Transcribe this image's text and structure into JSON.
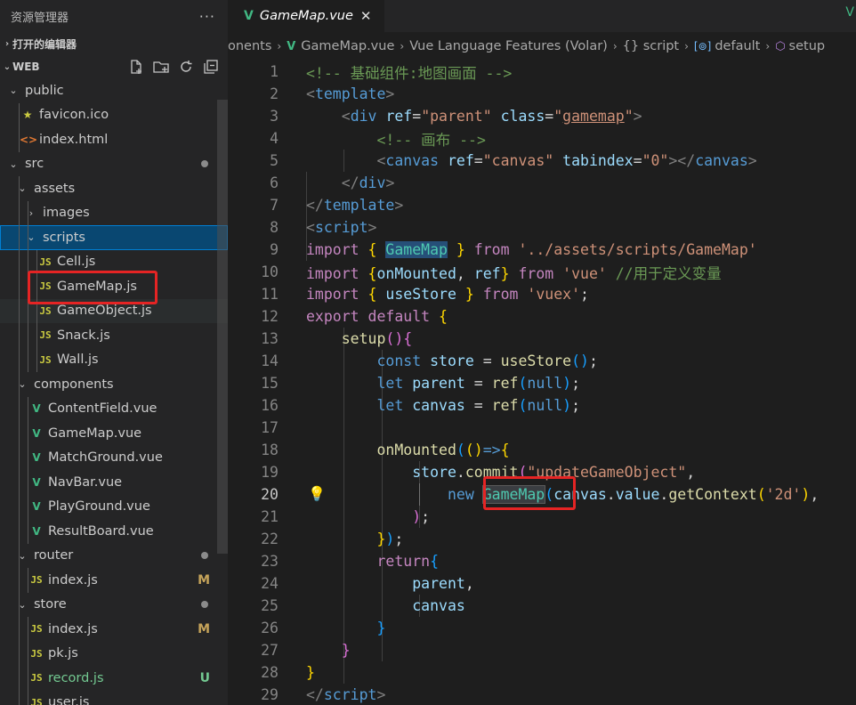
{
  "sidebar": {
    "title": "资源管理器",
    "more": "···",
    "open_editors": "打开的编辑器",
    "workspace": "WEB",
    "tree": [
      {
        "label": "public",
        "type": "folder",
        "depth": 0,
        "open": true
      },
      {
        "label": "favicon.ico",
        "type": "star",
        "depth": 1
      },
      {
        "label": "index.html",
        "type": "html",
        "depth": 1
      },
      {
        "label": "src",
        "type": "folder",
        "depth": 0,
        "open": true,
        "dot": true
      },
      {
        "label": "assets",
        "type": "folder",
        "depth": 1,
        "open": true
      },
      {
        "label": "images",
        "type": "folder",
        "depth": 2,
        "open": false
      },
      {
        "label": "scripts",
        "type": "folder",
        "depth": 2,
        "open": true,
        "selected": true
      },
      {
        "label": "Cell.js",
        "type": "js",
        "depth": 3
      },
      {
        "label": "GameMap.js",
        "type": "js",
        "depth": 3
      },
      {
        "label": "GameObject.js",
        "type": "js",
        "depth": 3,
        "hover": true
      },
      {
        "label": "Snack.js",
        "type": "js",
        "depth": 3
      },
      {
        "label": "Wall.js",
        "type": "js",
        "depth": 3
      },
      {
        "label": "components",
        "type": "folder",
        "depth": 1,
        "open": true
      },
      {
        "label": "ContentField.vue",
        "type": "vue",
        "depth": 2
      },
      {
        "label": "GameMap.vue",
        "type": "vue",
        "depth": 2
      },
      {
        "label": "MatchGround.vue",
        "type": "vue",
        "depth": 2
      },
      {
        "label": "NavBar.vue",
        "type": "vue",
        "depth": 2
      },
      {
        "label": "PlayGround.vue",
        "type": "vue",
        "depth": 2
      },
      {
        "label": "ResultBoard.vue",
        "type": "vue",
        "depth": 2
      },
      {
        "label": "router",
        "type": "folder",
        "depth": 1,
        "open": true,
        "dot": true
      },
      {
        "label": "index.js",
        "type": "js",
        "depth": 2,
        "badge": "M"
      },
      {
        "label": "store",
        "type": "folder",
        "depth": 1,
        "open": true,
        "dot": true
      },
      {
        "label": "index.js",
        "type": "js",
        "depth": 2,
        "badge": "M"
      },
      {
        "label": "pk.js",
        "type": "js",
        "depth": 2
      },
      {
        "label": "record.js",
        "type": "js",
        "depth": 2,
        "badge": "U",
        "untracked": true
      },
      {
        "label": "user.js",
        "type": "js",
        "depth": 2
      }
    ]
  },
  "icons": {
    "js": "JS",
    "vue": "V",
    "html": "<>",
    "star": "★",
    "chev_open": "⌄",
    "chev_closed": "›",
    "bulb": "💡"
  },
  "editor": {
    "tab": {
      "title": "GameMap.vue",
      "close": "✕"
    },
    "breadcrumb": [
      "onents",
      "GameMap.vue",
      "Vue Language Features (Volar)",
      "{} script",
      "default",
      "setup"
    ],
    "active_line": 20,
    "lines": [
      {
        "n": 1,
        "tokens": [
          [
            "cm",
            "<!-- 基础组件:地图画面 -->"
          ]
        ]
      },
      {
        "n": 2,
        "tokens": [
          [
            "br",
            "<"
          ],
          [
            "tag",
            "template"
          ],
          [
            "br",
            ">"
          ]
        ]
      },
      {
        "n": 3,
        "tokens": [
          [
            "t",
            "    "
          ],
          [
            "br",
            "<"
          ],
          [
            "tag",
            "div"
          ],
          [
            "t",
            " "
          ],
          [
            "attr",
            "ref"
          ],
          [
            "t",
            "="
          ],
          [
            "str",
            "\"parent\""
          ],
          [
            "t",
            " "
          ],
          [
            "attr",
            "class"
          ],
          [
            "t",
            "="
          ],
          [
            "str",
            "\""
          ],
          [
            "strul",
            "gamemap"
          ],
          [
            "str",
            "\""
          ],
          [
            "br",
            ">"
          ]
        ]
      },
      {
        "n": 4,
        "tokens": [
          [
            "t",
            "        "
          ],
          [
            "cm",
            "<!-- 画布 -->"
          ]
        ]
      },
      {
        "n": 5,
        "tokens": [
          [
            "t",
            "        "
          ],
          [
            "br",
            "<"
          ],
          [
            "tag",
            "canvas"
          ],
          [
            "t",
            " "
          ],
          [
            "attr",
            "ref"
          ],
          [
            "t",
            "="
          ],
          [
            "str",
            "\"canvas\""
          ],
          [
            "t",
            " "
          ],
          [
            "attr",
            "tabindex"
          ],
          [
            "t",
            "="
          ],
          [
            "str",
            "\"0\""
          ],
          [
            "br",
            "></"
          ],
          [
            "tag",
            "canvas"
          ],
          [
            "br",
            ">"
          ]
        ]
      },
      {
        "n": 6,
        "tokens": [
          [
            "t",
            "    "
          ],
          [
            "br",
            "</"
          ],
          [
            "tag",
            "div"
          ],
          [
            "br",
            ">"
          ]
        ]
      },
      {
        "n": 7,
        "tokens": [
          [
            "br",
            "</"
          ],
          [
            "tag",
            "template"
          ],
          [
            "br",
            ">"
          ]
        ]
      },
      {
        "n": 8,
        "tokens": [
          [
            "br",
            "<"
          ],
          [
            "tag",
            "script"
          ],
          [
            "br",
            ">"
          ]
        ]
      },
      {
        "n": 9,
        "tokens": [
          [
            "kw",
            "import"
          ],
          [
            "t",
            " "
          ],
          [
            "p1",
            "{"
          ],
          [
            "t",
            " "
          ],
          [
            "varsel",
            "GameMap"
          ],
          [
            "t",
            " "
          ],
          [
            "p1",
            "}"
          ],
          [
            "t",
            " "
          ],
          [
            "kw",
            "from"
          ],
          [
            "t",
            " "
          ],
          [
            "str",
            "'../assets/scripts/GameMap'"
          ]
        ]
      },
      {
        "n": 10,
        "tokens": [
          [
            "kw",
            "import"
          ],
          [
            "t",
            " "
          ],
          [
            "p1",
            "{"
          ],
          [
            "var",
            "onMounted"
          ],
          [
            "t",
            ", "
          ],
          [
            "var",
            "ref"
          ],
          [
            "p1",
            "}"
          ],
          [
            "t",
            " "
          ],
          [
            "kw",
            "from"
          ],
          [
            "t",
            " "
          ],
          [
            "str",
            "'vue'"
          ],
          [
            "t",
            " "
          ],
          [
            "cm",
            "//用于定义变量"
          ]
        ]
      },
      {
        "n": 11,
        "tokens": [
          [
            "kw",
            "import"
          ],
          [
            "t",
            " "
          ],
          [
            "p1",
            "{"
          ],
          [
            "t",
            " "
          ],
          [
            "var",
            "useStore"
          ],
          [
            "t",
            " "
          ],
          [
            "p1",
            "}"
          ],
          [
            "t",
            " "
          ],
          [
            "kw",
            "from"
          ],
          [
            "t",
            " "
          ],
          [
            "str",
            "'vuex'"
          ],
          [
            "t",
            ";"
          ]
        ]
      },
      {
        "n": 12,
        "tokens": [
          [
            "kw",
            "export"
          ],
          [
            "t",
            " "
          ],
          [
            "kw",
            "default"
          ],
          [
            "t",
            " "
          ],
          [
            "p1",
            "{"
          ]
        ]
      },
      {
        "n": 13,
        "tokens": [
          [
            "t",
            "    "
          ],
          [
            "fn",
            "setup"
          ],
          [
            "p2",
            "()"
          ],
          [
            "p2",
            "{"
          ]
        ]
      },
      {
        "n": 14,
        "tokens": [
          [
            "t",
            "        "
          ],
          [
            "kb",
            "const"
          ],
          [
            "t",
            " "
          ],
          [
            "var",
            "store"
          ],
          [
            "t",
            " = "
          ],
          [
            "fn",
            "useStore"
          ],
          [
            "p3",
            "()"
          ],
          [
            "t",
            ";"
          ]
        ]
      },
      {
        "n": 15,
        "tokens": [
          [
            "t",
            "        "
          ],
          [
            "kb",
            "let"
          ],
          [
            "t",
            " "
          ],
          [
            "var",
            "parent"
          ],
          [
            "t",
            " = "
          ],
          [
            "fn",
            "ref"
          ],
          [
            "p3",
            "("
          ],
          [
            "kb",
            "null"
          ],
          [
            "p3",
            ")"
          ],
          [
            "t",
            ";"
          ]
        ]
      },
      {
        "n": 16,
        "tokens": [
          [
            "t",
            "        "
          ],
          [
            "kb",
            "let"
          ],
          [
            "t",
            " "
          ],
          [
            "var",
            "canvas"
          ],
          [
            "t",
            " = "
          ],
          [
            "fn",
            "ref"
          ],
          [
            "p3",
            "("
          ],
          [
            "kb",
            "null"
          ],
          [
            "p3",
            ")"
          ],
          [
            "t",
            ";"
          ]
        ]
      },
      {
        "n": 17,
        "tokens": []
      },
      {
        "n": 18,
        "tokens": [
          [
            "t",
            "        "
          ],
          [
            "fn",
            "onMounted"
          ],
          [
            "p3",
            "("
          ],
          [
            "p1",
            "()"
          ],
          [
            "kb",
            "=>"
          ],
          [
            "p1",
            "{"
          ]
        ]
      },
      {
        "n": 19,
        "tokens": [
          [
            "t",
            "            "
          ],
          [
            "var",
            "store"
          ],
          [
            "t",
            "."
          ],
          [
            "fn",
            "commit"
          ],
          [
            "p2",
            "("
          ],
          [
            "str",
            "\"updateGameObject\""
          ],
          [
            "t",
            ","
          ]
        ]
      },
      {
        "n": 20,
        "tokens": [
          [
            "t",
            "                "
          ],
          [
            "kb",
            "new"
          ],
          [
            "t",
            " "
          ],
          [
            "clshl",
            "GameMap"
          ],
          [
            "p3",
            "("
          ],
          [
            "var",
            "canvas"
          ],
          [
            "t",
            "."
          ],
          [
            "var",
            "value"
          ],
          [
            "t",
            "."
          ],
          [
            "fn",
            "getContext"
          ],
          [
            "p1",
            "("
          ],
          [
            "str",
            "'2d'"
          ],
          [
            "p1",
            ")"
          ],
          [
            "t",
            ","
          ]
        ]
      },
      {
        "n": 21,
        "tokens": [
          [
            "t",
            "            "
          ],
          [
            "p2",
            ")"
          ],
          [
            "t",
            ";"
          ]
        ]
      },
      {
        "n": 22,
        "tokens": [
          [
            "t",
            "        "
          ],
          [
            "p1",
            "}"
          ],
          [
            "p3",
            ")"
          ],
          [
            "t",
            ";"
          ]
        ]
      },
      {
        "n": 23,
        "tokens": [
          [
            "t",
            "        "
          ],
          [
            "kw",
            "return"
          ],
          [
            "p3",
            "{"
          ]
        ]
      },
      {
        "n": 24,
        "tokens": [
          [
            "t",
            "            "
          ],
          [
            "var",
            "parent"
          ],
          [
            "t",
            ","
          ]
        ]
      },
      {
        "n": 25,
        "tokens": [
          [
            "t",
            "            "
          ],
          [
            "var",
            "canvas"
          ]
        ]
      },
      {
        "n": 26,
        "tokens": [
          [
            "t",
            "        "
          ],
          [
            "p3",
            "}"
          ]
        ]
      },
      {
        "n": 27,
        "tokens": [
          [
            "t",
            "    "
          ],
          [
            "p2",
            "}"
          ]
        ]
      },
      {
        "n": 28,
        "tokens": [
          [
            "p1",
            "}"
          ]
        ]
      },
      {
        "n": 29,
        "tokens": [
          [
            "br",
            "</"
          ],
          [
            "tag",
            "script"
          ],
          [
            "br",
            ">"
          ]
        ]
      }
    ]
  }
}
